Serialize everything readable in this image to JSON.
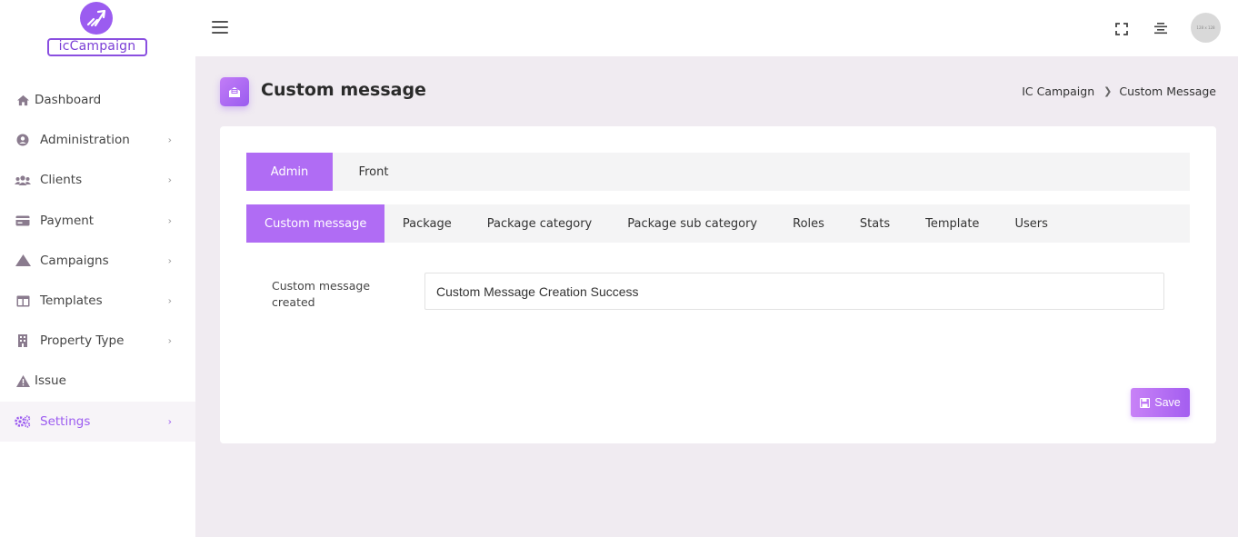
{
  "app": {
    "logo_text": "icCampaign",
    "brand_color": "#9b5cf0"
  },
  "sidebar": {
    "items": [
      {
        "label": "Dashboard",
        "icon": "home-icon",
        "has_chevron": false,
        "active": false
      },
      {
        "label": "Administration",
        "icon": "user-circle-icon",
        "has_chevron": true,
        "active": false
      },
      {
        "label": "Clients",
        "icon": "users-icon",
        "has_chevron": true,
        "active": false
      },
      {
        "label": "Payment",
        "icon": "credit-card-icon",
        "has_chevron": true,
        "active": false
      },
      {
        "label": "Campaigns",
        "icon": "mountain-icon",
        "has_chevron": true,
        "active": false
      },
      {
        "label": "Templates",
        "icon": "table-icon",
        "has_chevron": true,
        "active": false
      },
      {
        "label": "Property Type",
        "icon": "building-icon",
        "has_chevron": true,
        "active": false
      },
      {
        "label": "Issue",
        "icon": "warning-icon",
        "has_chevron": false,
        "active": false
      },
      {
        "label": "Settings",
        "icon": "gears-icon",
        "has_chevron": true,
        "active": true
      }
    ]
  },
  "topbar": {
    "avatar_text": "128 x 128"
  },
  "page": {
    "title": "Custom message",
    "breadcrumb": [
      "IC Campaign",
      "Custom Message"
    ]
  },
  "tabs_primary": [
    {
      "label": "Admin",
      "active": true
    },
    {
      "label": "Front",
      "active": false
    }
  ],
  "tabs_secondary": [
    {
      "label": "Custom message",
      "active": true
    },
    {
      "label": "Package",
      "active": false
    },
    {
      "label": "Package category",
      "active": false
    },
    {
      "label": "Package sub category",
      "active": false
    },
    {
      "label": "Roles",
      "active": false
    },
    {
      "label": "Stats",
      "active": false
    },
    {
      "label": "Template",
      "active": false
    },
    {
      "label": "Users",
      "active": false
    }
  ],
  "form": {
    "field_label": "Custom message created",
    "field_value": "Custom Message Creation Success",
    "save_label": "Save"
  }
}
